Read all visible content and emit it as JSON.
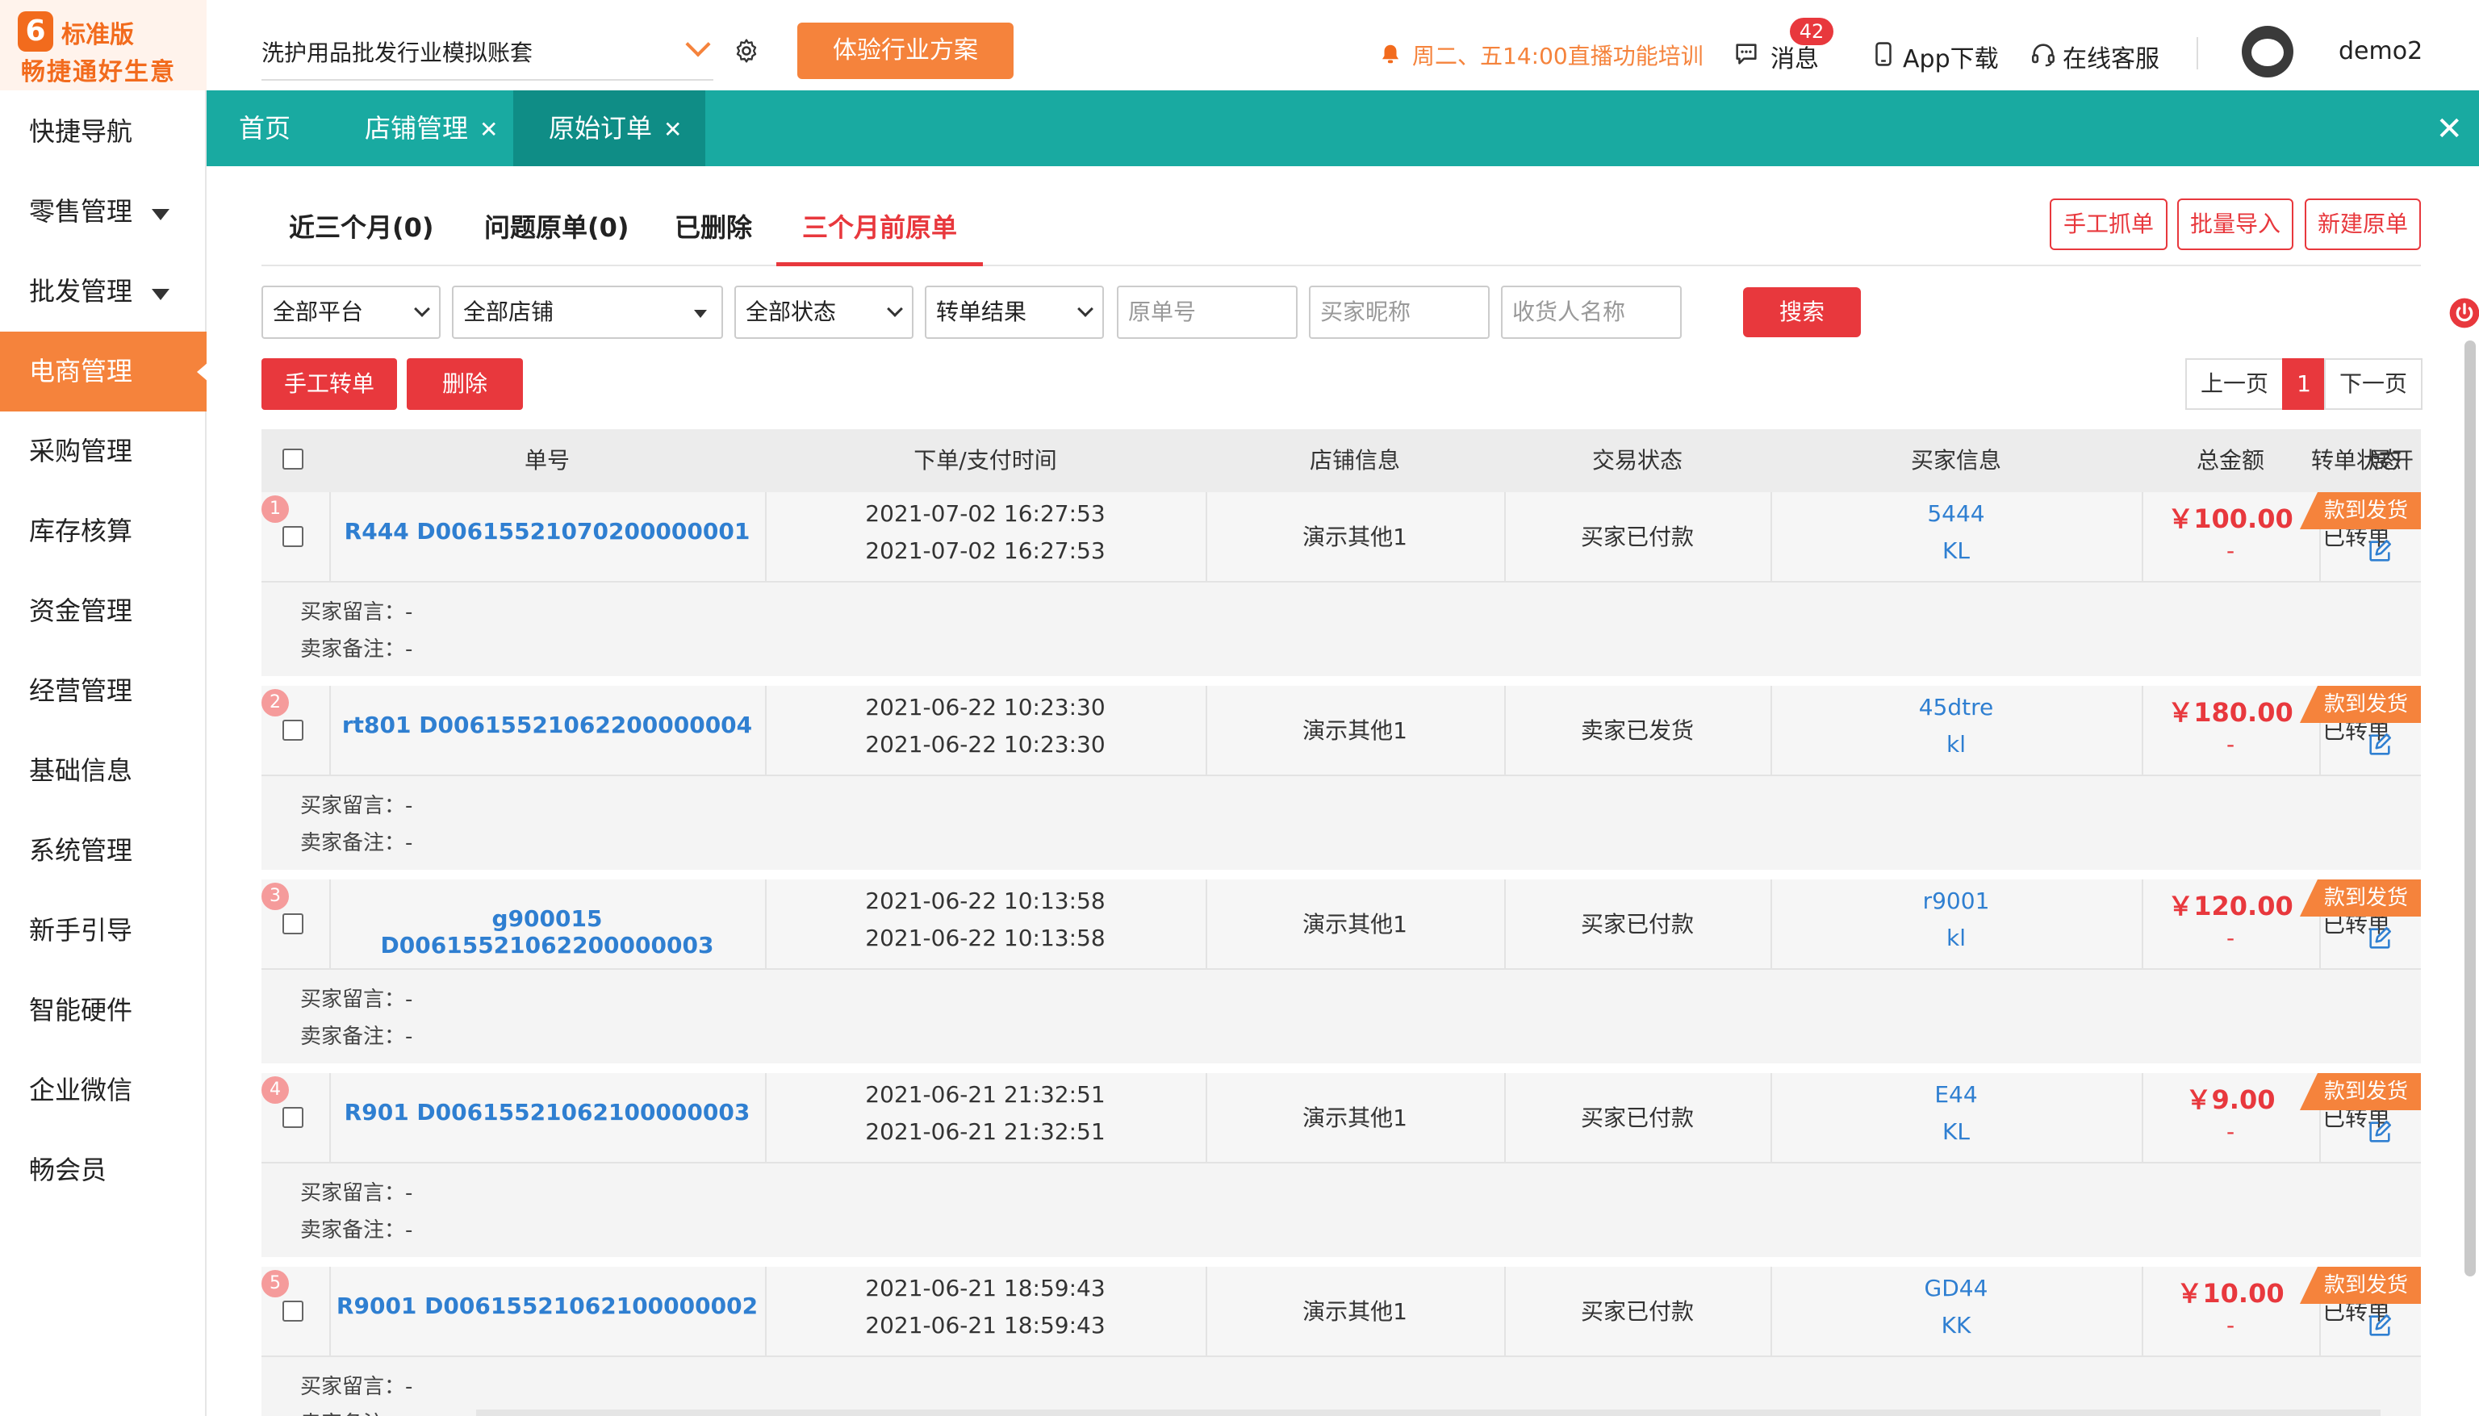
{
  "logo": {
    "edition": "标准版",
    "brand": "畅捷通好生意",
    "badge": "6"
  },
  "sidebar": {
    "items": [
      {
        "label": "快捷导航",
        "has_caret": false,
        "active": false
      },
      {
        "label": "零售管理",
        "has_caret": true,
        "active": false
      },
      {
        "label": "批发管理",
        "has_caret": true,
        "active": false
      },
      {
        "label": "电商管理",
        "has_caret": false,
        "active": true
      },
      {
        "label": "采购管理",
        "has_caret": false,
        "active": false
      },
      {
        "label": "库存核算",
        "has_caret": false,
        "active": false
      },
      {
        "label": "资金管理",
        "has_caret": false,
        "active": false
      },
      {
        "label": "经营管理",
        "has_caret": false,
        "active": false
      },
      {
        "label": "基础信息",
        "has_caret": false,
        "active": false
      },
      {
        "label": "系统管理",
        "has_caret": false,
        "active": false
      },
      {
        "label": "新手引导",
        "has_caret": false,
        "active": false
      },
      {
        "label": "智能硬件",
        "has_caret": false,
        "active": false
      },
      {
        "label": "企业微信",
        "has_caret": false,
        "active": false
      },
      {
        "label": "畅会员",
        "has_caret": false,
        "active": false
      }
    ]
  },
  "header": {
    "account": "洗护用品批发行业模拟账套",
    "try_button": "体验行业方案",
    "notice": "周二、五14:00直播功能培训",
    "messages_label": "消息",
    "messages_count": "42",
    "app_download": "App下载",
    "online_service": "在线客服",
    "username": "demo2"
  },
  "tabs": [
    {
      "label": "首页",
      "closable": false,
      "active": false
    },
    {
      "label": "店铺管理",
      "closable": true,
      "active": false
    },
    {
      "label": "原始订单",
      "closable": true,
      "active": true
    }
  ],
  "subtabs": [
    {
      "label": "近三个月(0)",
      "active": false
    },
    {
      "label": "问题原单(0)",
      "active": false
    },
    {
      "label": "已删除",
      "active": false
    },
    {
      "label": "三个月前原单",
      "active": true
    }
  ],
  "actions": {
    "manual_grab": "手工抓单",
    "batch_import": "批量导入",
    "new_order": "新建原单"
  },
  "filters": {
    "platform": "全部平台",
    "store": "全部店铺",
    "status": "全部状态",
    "convert_result": "转单结果",
    "order_no_placeholder": "原单号",
    "buyer_nick_placeholder": "买家昵称",
    "receiver_placeholder": "收货人名称",
    "search_button": "搜索"
  },
  "ops": {
    "manual_convert": "手工转单",
    "delete": "删除"
  },
  "pager": {
    "prev": "上一页",
    "current": "1",
    "next": "下一页"
  },
  "columns": [
    "单号",
    "下单/支付时间",
    "店铺信息",
    "交易状态",
    "买家信息",
    "总金额",
    "转单状态",
    "展开"
  ],
  "orders": [
    {
      "index": "1",
      "order_no": "R444 D00615521070200000001",
      "order_time": "2021-07-02 16:27:53",
      "pay_time": "2021-07-02 16:27:53",
      "store": "演示其他1",
      "trade_status": "买家已付款",
      "buyer": "5444",
      "receiver": "KL",
      "amount": "￥100.00",
      "amount_sub": "-",
      "convert_status": "已转单",
      "flag": "款到发货",
      "buyer_msg_label": "买家留言：-",
      "seller_note_label": "卖家备注：-"
    },
    {
      "index": "2",
      "order_no": "rt801 D00615521062200000004",
      "order_time": "2021-06-22 10:23:30",
      "pay_time": "2021-06-22 10:23:30",
      "store": "演示其他1",
      "trade_status": "卖家已发货",
      "buyer": "45dtre",
      "receiver": "kl",
      "amount": "￥180.00",
      "amount_sub": "-",
      "convert_status": "已转单",
      "flag": "款到发货",
      "buyer_msg_label": "买家留言：-",
      "seller_note_label": "卖家备注：-"
    },
    {
      "index": "3",
      "order_no": "g900015 D00615521062200000003",
      "order_time": "2021-06-22 10:13:58",
      "pay_time": "2021-06-22 10:13:58",
      "store": "演示其他1",
      "trade_status": "买家已付款",
      "buyer": "r9001",
      "receiver": "kl",
      "amount": "￥120.00",
      "amount_sub": "-",
      "convert_status": "已转单",
      "flag": "款到发货",
      "buyer_msg_label": "买家留言：-",
      "seller_note_label": "卖家备注：-"
    },
    {
      "index": "4",
      "order_no": "R901 D00615521062100000003",
      "order_time": "2021-06-21 21:32:51",
      "pay_time": "2021-06-21 21:32:51",
      "store": "演示其他1",
      "trade_status": "买家已付款",
      "buyer": "E44",
      "receiver": "KL",
      "amount": "￥9.00",
      "amount_sub": "-",
      "convert_status": "已转单",
      "flag": "款到发货",
      "buyer_msg_label": "买家留言：-",
      "seller_note_label": "卖家备注：-"
    },
    {
      "index": "5",
      "order_no": "R9001 D00615521062100000002",
      "order_time": "2021-06-21 18:59:43",
      "pay_time": "2021-06-21 18:59:43",
      "store": "演示其他1",
      "trade_status": "买家已付款",
      "buyer": "GD44",
      "receiver": "KK",
      "amount": "￥10.00",
      "amount_sub": "-",
      "convert_status": "已转单",
      "flag": "款到发货",
      "buyer_msg_label": "买家留言：-",
      "seller_note_label": "卖家备注：-"
    }
  ],
  "colors": {
    "accent_orange": "#f5833c",
    "teal": "#19aaa1",
    "red": "#e8383d",
    "link_blue": "#2f7fd1"
  }
}
